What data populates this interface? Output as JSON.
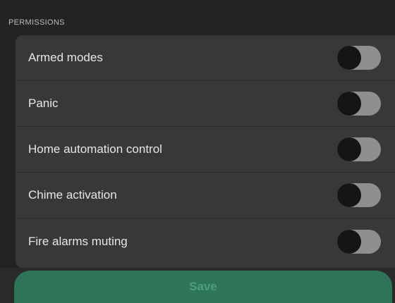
{
  "section": {
    "header": "PERMISSIONS"
  },
  "permissions": [
    {
      "label": "Armed modes",
      "enabled": false
    },
    {
      "label": "Panic",
      "enabled": false
    },
    {
      "label": "Home automation control",
      "enabled": false
    },
    {
      "label": "Chime activation",
      "enabled": false
    },
    {
      "label": "Fire alarms muting",
      "enabled": false
    }
  ],
  "footer": {
    "save_label": "Save",
    "save_disabled": true
  },
  "colors": {
    "background": "#232323",
    "card": "#383838",
    "toggle_track_off": "#8f8f8f",
    "toggle_knob": "#151515",
    "save_button": "#2d7458",
    "save_text": "#4f9c7e"
  }
}
